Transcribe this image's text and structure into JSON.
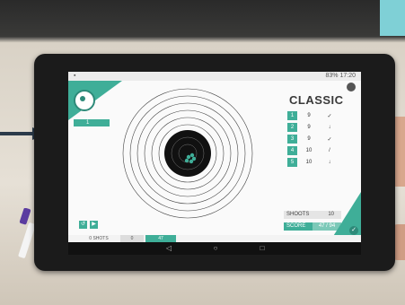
{
  "status_bar": {
    "battery": "83%",
    "time": "17:20"
  },
  "app": {
    "title": "CLASSIC",
    "shot_label": "1",
    "shots": [
      {
        "n": "1",
        "value": "9",
        "mark": "✓"
      },
      {
        "n": "2",
        "value": "9",
        "mark": "↓"
      },
      {
        "n": "3",
        "value": "9",
        "mark": "✓"
      },
      {
        "n": "4",
        "value": "10",
        "mark": "/"
      },
      {
        "n": "5",
        "value": "10",
        "mark": "↓"
      }
    ],
    "shoots_label": "SHOOTS",
    "shoots_value": "10",
    "score_label": "SCORE",
    "score_value": "47 / 94",
    "bottom_tabs": [
      "0 SHOTS",
      "0",
      "47"
    ],
    "ok_icon": "✓"
  },
  "colors": {
    "accent": "#3fae98",
    "accent_dark": "#2d8a79"
  }
}
